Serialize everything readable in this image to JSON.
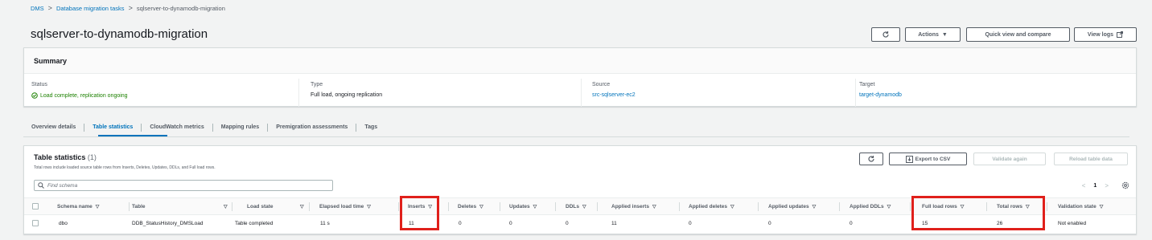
{
  "breadcrumb": {
    "items": [
      "DMS",
      "Database migration tasks",
      "sqlserver-to-dynamodb-migration"
    ],
    "separator": ">"
  },
  "page": {
    "title": "sqlserver-to-dynamodb-migration"
  },
  "header_actions": {
    "refresh_icon": "refresh-icon",
    "actions_label": "Actions",
    "quick_view_label": "Quick view and compare",
    "view_logs_label": "View logs"
  },
  "summary": {
    "title": "Summary",
    "fields": [
      {
        "label": "Status",
        "value": "Load complete, replication ongoing"
      },
      {
        "label": "Type",
        "value": "Full load, ongoing replication"
      },
      {
        "label": "Source",
        "value": "src-sqlserver-ec2"
      },
      {
        "label": "Target",
        "value": "target-dynamodb"
      }
    ]
  },
  "tabs": [
    {
      "label": "Overview details",
      "active": false
    },
    {
      "label": "Table statistics",
      "active": true
    },
    {
      "label": "CloudWatch metrics",
      "active": false
    },
    {
      "label": "Mapping rules",
      "active": false
    },
    {
      "label": "Premigration assessments",
      "active": false
    },
    {
      "label": "Tags",
      "active": false
    }
  ],
  "table_stats": {
    "title": "Table statistics",
    "count": "(1)",
    "description": "Total rows include loaded source table rows from Inserts, Deletes, Updates, DDLs, and Full load rows.",
    "export_label": "Export to CSV",
    "validate_label": "Validate again",
    "reload_label": "Reload table data",
    "search_placeholder": "Find schema",
    "page_number": "1",
    "columns": [
      "Schema name",
      "Table",
      "Load state",
      "Elapsed load time",
      "Inserts",
      "Deletes",
      "Updates",
      "DDLs",
      "Applied inserts",
      "Applied deletes",
      "Applied updates",
      "Applied DDLs",
      "Full load rows",
      "Total rows",
      "Validation state"
    ],
    "rows": [
      [
        "dbo",
        "DDB_StatusHistory_DMSLoad",
        "Table completed",
        "11 s",
        "11",
        "0",
        "0",
        "0",
        "11",
        "0",
        "0",
        "0",
        "15",
        "26",
        "Not enabled"
      ]
    ]
  },
  "colors": {
    "link": "#0073bb",
    "success": "#1d8102",
    "highlight": "#e0201b"
  }
}
